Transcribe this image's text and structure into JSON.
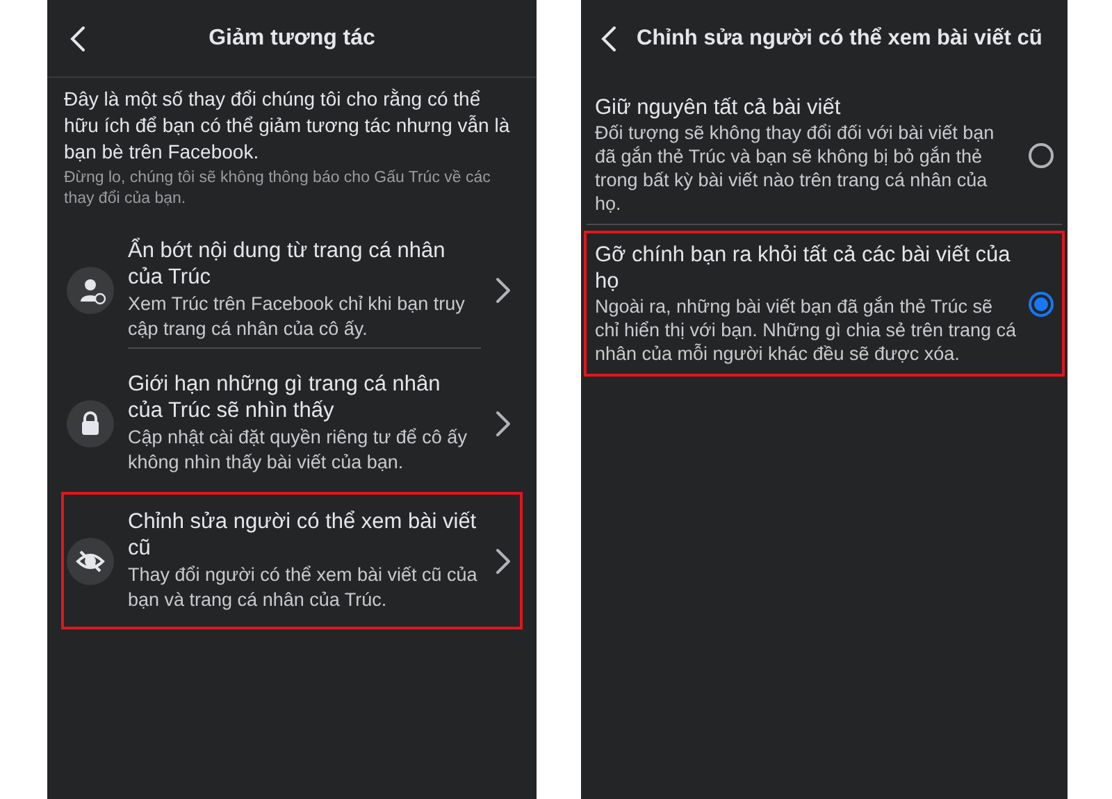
{
  "left_screen": {
    "title": "Giảm tương tác",
    "intro": "Đây là một số thay đổi chúng tôi cho rằng có thể hữu ích để bạn có thể giảm tương tác nhưng vẫn là bạn bè trên Facebook.",
    "note": "Đừng lo, chúng tôi sẽ không thông báo cho Gấu Trúc về các thay đổi của bạn.",
    "items": [
      {
        "kind": "person",
        "title": "Ẩn bớt nội dung từ trang cá nhân của Trúc",
        "description": "Xem Trúc trên Facebook chỉ khi bạn truy cập trang cá nhân của cô ấy.",
        "highlighted": false
      },
      {
        "kind": "lock",
        "title": "Giới hạn những gì trang cá nhân của Trúc sẽ nhìn thấy",
        "description": "Cập nhật cài đặt quyền riêng tư để cô ấy không nhìn thấy bài viết của bạn.",
        "highlighted": false
      },
      {
        "kind": "eye",
        "title": "Chỉnh sửa người có thể xem bài viết cũ",
        "description": "Thay đổi người có thể xem bài viết cũ của bạn và trang cá nhân của Trúc.",
        "highlighted": true
      }
    ]
  },
  "right_screen": {
    "title": "Chỉnh sửa người có thể xem bài viết cũ",
    "options": [
      {
        "title": "Giữ nguyên tất cả bài viết",
        "description": "Đối tượng sẽ không thay đổi đối với bài viết bạn đã gắn thẻ Trúc và bạn sẽ không bị bỏ gắn thẻ trong bất kỳ bài viết nào trên trang cá nhân của họ.",
        "selected": false,
        "highlighted": false
      },
      {
        "title": "Gỡ chính bạn ra khỏi tất cả các bài viết của họ",
        "description": "Ngoài ra, những bài viết bạn đã gắn thẻ Trúc sẽ chỉ hiển thị với bạn. Những gì chia sẻ trên trang cá nhân của mỗi người khác đều sẽ được xóa.",
        "selected": true,
        "highlighted": true
      }
    ]
  }
}
